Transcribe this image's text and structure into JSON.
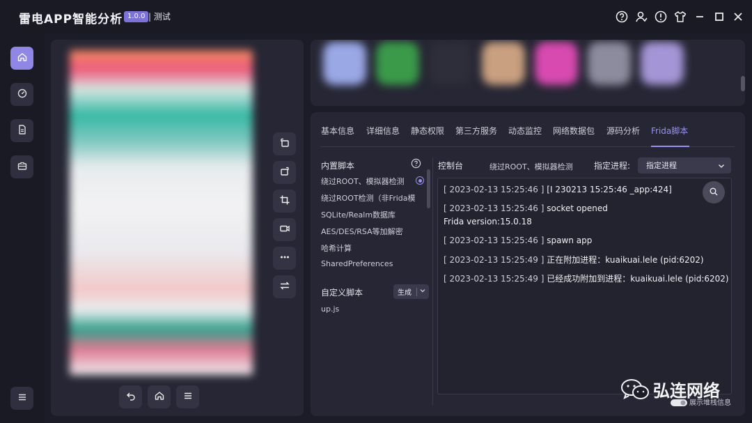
{
  "app": {
    "title": "雷电APP智能分析",
    "version": "1.0.0",
    "env": "| 测试"
  },
  "window_controls": [
    "help-icon",
    "user-icon",
    "info-icon",
    "shirt-icon",
    "minimize-icon",
    "maximize-icon",
    "close-icon"
  ],
  "sidebar": {
    "items": [
      {
        "icon": "home-icon",
        "active": true
      },
      {
        "icon": "dashboard-icon",
        "active": false
      },
      {
        "icon": "document-icon",
        "active": false
      },
      {
        "icon": "toolbox-icon",
        "active": false
      }
    ],
    "menu_icon": "menu-icon"
  },
  "device_tools": [
    "rotate-left-icon",
    "rotate-right-icon",
    "crop-icon",
    "record-icon",
    "more-icon",
    "swap-icon"
  ],
  "device_nav": [
    "back-icon",
    "home-icon",
    "menu-icon"
  ],
  "tabs": [
    {
      "label": "基本信息"
    },
    {
      "label": "详细信息"
    },
    {
      "label": "静态权限"
    },
    {
      "label": "第三方服务"
    },
    {
      "label": "动态监控"
    },
    {
      "label": "网络数据包"
    },
    {
      "label": "源码分析"
    },
    {
      "label": "Frida脚本",
      "active": true
    }
  ],
  "builtin": {
    "title": "内置脚本",
    "items": [
      "绕过ROOT、模拟器检测",
      "绕过ROOT检测（非Frida模",
      "SQLite/Realm数据库",
      "AES/DES/RSA等加解密",
      "哈希计算",
      "SharedPreferences"
    ]
  },
  "custom": {
    "title": "自定义脚本",
    "generate_label": "生成",
    "items": [
      "up.js"
    ]
  },
  "console": {
    "title": "控制台",
    "current_script": "绕过ROOT、模拟器检测",
    "process_label": "指定进程:",
    "process_value": "指定进程",
    "logs": [
      {
        "ts": "[ 2023-02-13 15:25:46 ]",
        "msg": "[I 230213 15:25:46 _app:424]"
      },
      {
        "ts": "[ 2023-02-13 15:25:46 ]",
        "msg": "socket opened"
      },
      {
        "ts": "",
        "msg": "Frida version:15.0.18"
      },
      {
        "ts": "[ 2023-02-13 15:25:46 ]",
        "msg": "spawn app"
      },
      {
        "ts": "[ 2023-02-13 15:25:49 ]",
        "msg": "正在附加进程：kuaikuai.lele (pid:6202)"
      },
      {
        "ts": "[ 2023-02-13 15:25:49 ]",
        "msg": "已经成功附加到进程：kuaikuai.lele (pid:6202)"
      }
    ]
  },
  "watermark": {
    "name": "弘连网络",
    "sub": "展示堆栈信息"
  },
  "colors": {
    "accent": "#9a92f0",
    "background": "#1c1c28",
    "panel": "#262634"
  }
}
